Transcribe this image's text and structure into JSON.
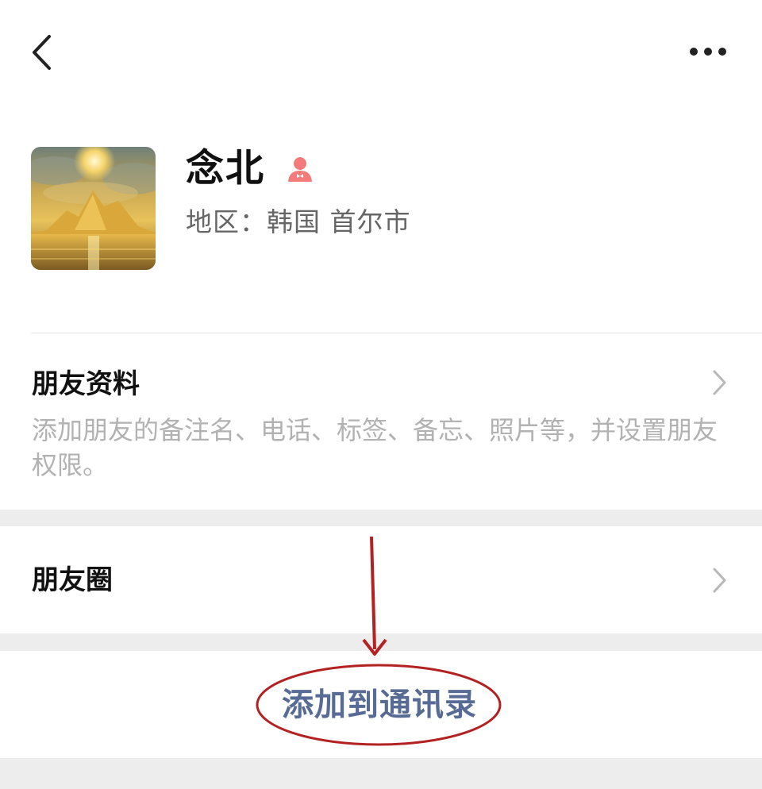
{
  "header": {
    "back_icon": "chevron-left-icon",
    "more_icon": "more-horizontal-icon"
  },
  "profile": {
    "name": "念北",
    "gender_icon": "female-person-icon",
    "gender_color": "#f37b7b",
    "region": "地区：韩国 首尔市"
  },
  "friend_info": {
    "title": "朋友资料",
    "description": "添加朋友的备注名、电话、标签、备忘、照片等，并设置朋友权限。"
  },
  "moments": {
    "title": "朋友圈"
  },
  "action": {
    "add_label": "添加到通讯录",
    "link_color": "#576b95"
  },
  "annotation": {
    "color": "#b22222"
  }
}
